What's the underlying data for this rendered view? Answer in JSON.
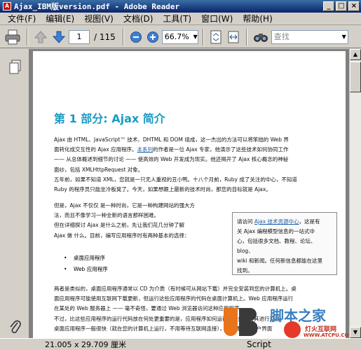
{
  "window": {
    "title": "Ajax_IBM版version.pdf - Adobe Reader",
    "min": "_",
    "max": "□",
    "close": "×"
  },
  "menu": [
    "文件(F)",
    "编辑(E)",
    "视图(V)",
    "文档(D)",
    "工具(T)",
    "窗口(W)",
    "帮助(H)"
  ],
  "toolbar": {
    "page_value": "1",
    "page_total": "/ 115",
    "zoom": "66.7%",
    "search_placeholder": "查找"
  },
  "content": {
    "heading": "第 1 部分: Ajax 简介",
    "p1": [
      "Ajax 由 HTML、JavaScript™ 技术、DHTML 和 DOM 组成，这一杰出的方法可以将笨拙的 Web 界",
      "面转化成交互性的 Ajax 应用程序。",
      "本系列",
      "的作者是一位 Ajax 专家，他演示了这些技术如何协同工作",
      "—— 从总体概述到细节的讨论 —— 使高效的 Web 开发成为现实。他还揭开了 Ajax 核心概念的神秘",
      "面纱，包括 XMLHttpRequest 对象。"
    ],
    "p2": [
      "五年前，如果不知道 XML，您就是一只无人重视的丑小鸭。十八个月前，Ruby 成了关注的中心，不知道",
      "Ruby 的程序员只能坐冷板凳了。今天，如果想跟上最新的技术时尚，那您的目标就是 Ajax。"
    ],
    "p3": [
      "但是，Ajax 不仅仅 是一种时尚，它是一种构建网站的强大方",
      "法，而且不像学习一种全新的语言那样困难。",
      "但在详细探讨 Ajax 是什么之前，先让我们花几分钟了解",
      "Ajax 做 什么。目前，编写应用程序时有两种基本的选择："
    ],
    "bullets": [
      "桌面应用程序",
      "Web 应用程序"
    ],
    "sidebox": [
      "请访问 ",
      "Ajax 技术资源中心",
      "，这是有",
      "关 Ajax 编程模型信息的一站式中",
      "心，包括很多文档、教程、论坛、blog、",
      "wiki 和新闻。任何新信息都能在这里",
      "找到。"
    ],
    "p4": [
      "两者是类似的，桌面应用程序通常以 CD 为介质（有时候可从网站下载）并完全安装到您的计算机上。桌",
      "面应用程序可能使用互联网下载更新，但运行这些应用程序的代码在桌面计算机上。Web 应用程序运行",
      "在某处的 Web 服务器上 —— 毫不奇怪，要通过 Web 浏览器访问这种应用程序。",
      "不过，比这些应用程序的运行代码放在何处更重要的是，应用程序如何运行以及如何与其进行交互。",
      "桌面应用程序一般很快（就在您的计算机上运行，不用等待互联网连接），具有漂亮的用户界面"
    ]
  },
  "status": {
    "page_size": "21.005 x 29.709 厘米"
  },
  "watermarks": {
    "site1": "脚本之家",
    "site2": "灯火互联网",
    "site2_url": "WWW.ATCPU.COM",
    "script_label": "Script"
  }
}
